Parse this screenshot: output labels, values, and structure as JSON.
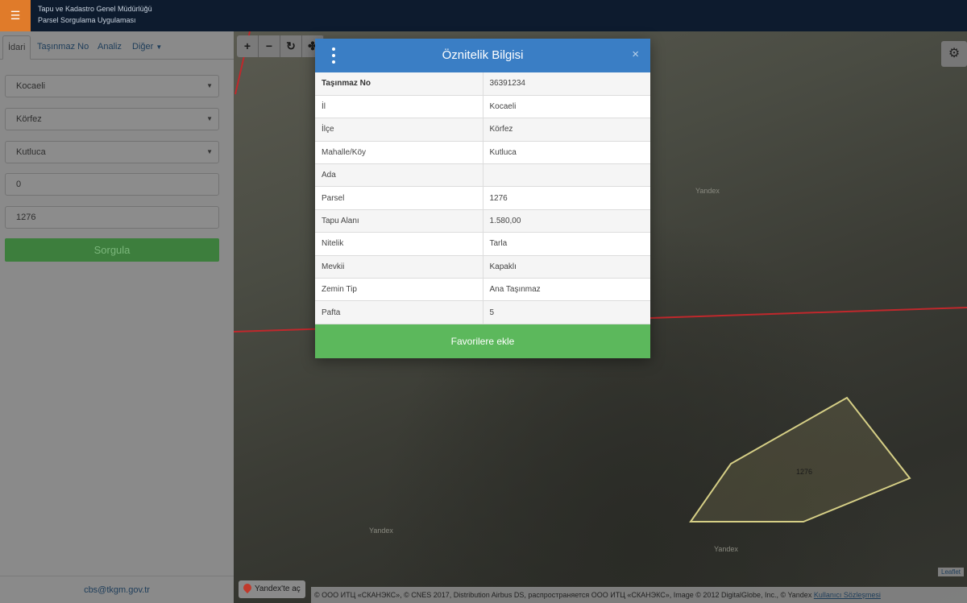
{
  "header": {
    "menu_icon": "hamburger-icon",
    "brand_line1": "Tapu ve Kadastro Genel Müdürlüğü",
    "brand_line2": "Parsel Sorgulama Uygulaması"
  },
  "sidebar": {
    "tabs": [
      {
        "label": "İdari"
      },
      {
        "label": "Taşınmaz No"
      },
      {
        "label": "Analiz"
      },
      {
        "label": "Diğer"
      }
    ],
    "fields": {
      "il": "Kocaeli",
      "ilce": "Körfez",
      "mahalle": "Kutluca",
      "ada": "0",
      "parsel": "1276"
    },
    "query_button": "Sorgula",
    "footer_email": "cbs@tkgm.gov.tr"
  },
  "map": {
    "watermarks": [
      "Yandex",
      "Yandex",
      "Yandex"
    ],
    "parcel_label": "1276",
    "yandex_open": "Yandex'te aç",
    "copyright": "© ООО ИТЦ «СКАНЭКС», © CNES 2017, Distribution Airbus DS, распространяется ООО ИТЦ «СКАНЭКС», Image © 2012 DigitalGlobe, Inc., © Yandex",
    "copyright_link": "Kullanıcı Sözleşmesi",
    "leaflet": "Leaflet"
  },
  "modal": {
    "title": "Öznitelik Bilgisi",
    "close": "×",
    "rows": [
      {
        "key": "Taşınmaz No",
        "value": "36391234"
      },
      {
        "key": "İl",
        "value": "Kocaeli"
      },
      {
        "key": "İlçe",
        "value": "Körfez"
      },
      {
        "key": "Mahalle/Köy",
        "value": "Kutluca"
      },
      {
        "key": "Ada",
        "value": ""
      },
      {
        "key": "Parsel",
        "value": "1276"
      },
      {
        "key": "Tapu Alanı",
        "value": "1.580,00"
      },
      {
        "key": "Nitelik",
        "value": "Tarla"
      },
      {
        "key": "Mevkii",
        "value": "Kapaklı"
      },
      {
        "key": "Zemin Tip",
        "value": "Ana Taşınmaz"
      },
      {
        "key": "Pafta",
        "value": "5"
      }
    ],
    "favorite_button": "Favorilere ekle"
  },
  "colors": {
    "header_bg": "#0d1b2e",
    "menu_accent": "#e07b2a",
    "modal_header": "#3a7ec5",
    "success": "#5cb85c",
    "query_button": "#3d7e3d",
    "parcel_outline": "#d6cf86",
    "boundary_red": "#c0282c"
  }
}
